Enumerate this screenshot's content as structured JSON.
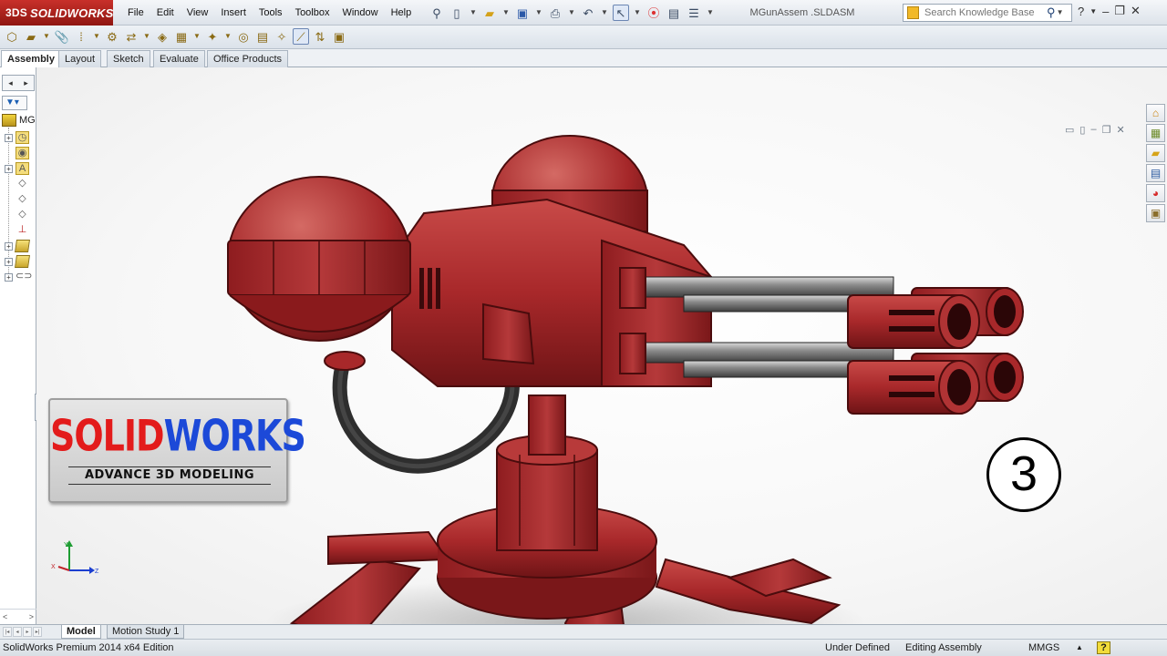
{
  "app": {
    "brand": "SOLIDWORKS",
    "brand_prefix": "3DS"
  },
  "menu": [
    "File",
    "Edit",
    "View",
    "Insert",
    "Tools",
    "Toolbox",
    "Window",
    "Help"
  ],
  "document_title": "MGunAssem .SLDASM",
  "search": {
    "placeholder": "Search Knowledge Base"
  },
  "command_tabs": [
    "Assembly",
    "Layout",
    "Sketch",
    "Evaluate",
    "Office Products"
  ],
  "active_command_tab": "Assembly",
  "feature_tree": {
    "root_label": "MG"
  },
  "overlay": {
    "badge_red": "SOLID",
    "badge_blue": "WORKS",
    "badge_subtitle": "ADVANCE 3D MODELING",
    "episode_number": "3"
  },
  "triad": {
    "x_label": "X",
    "y_label": "Y",
    "z_label": "Z"
  },
  "bottom_tabs": [
    "Model",
    "Motion Study 1"
  ],
  "active_bottom_tab": "Model",
  "status": {
    "edition": "SolidWorks Premium 2014 x64 Edition",
    "definition": "Under Defined",
    "mode": "Editing Assembly",
    "units": "MMGS",
    "units_arrow": "▲",
    "help": "?"
  },
  "colors": {
    "brand_red": "#c8302a",
    "turret_red": "#a8282a",
    "badge_red": "#e31b1b",
    "badge_blue": "#1c49d8"
  }
}
